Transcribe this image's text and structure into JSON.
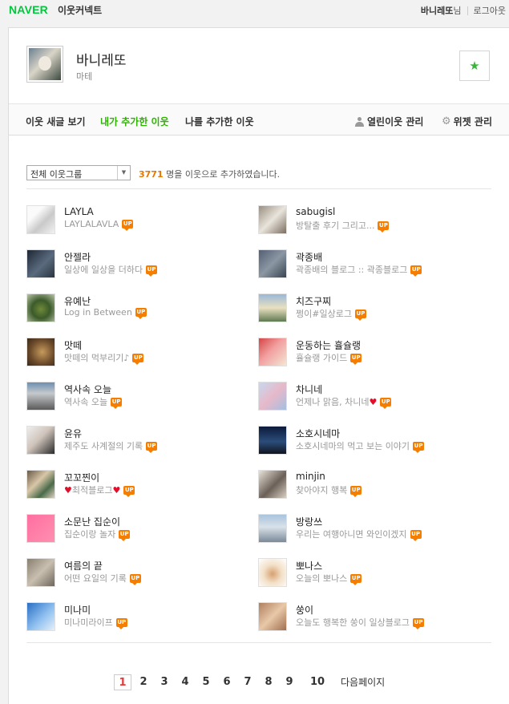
{
  "topbar": {
    "logo": "NAVER",
    "service": "이웃커넥트",
    "username": "바니레또",
    "nim": "님",
    "logout": "로그아웃"
  },
  "profile": {
    "name": "바니레또",
    "sub": "마테"
  },
  "tabs": {
    "new_posts": "이웃 새글 보기",
    "added_by_me": "내가 추가한 이웃",
    "added_me": "나를 추가한 이웃",
    "open_manage": "열린이웃 관리",
    "widget_manage": "위젯 관리"
  },
  "filter": {
    "group_select": "전체 이웃그룹",
    "count": "3771",
    "count_suffix": "명을 이웃으로 추가하였습니다."
  },
  "neighbors": [
    {
      "name": "LAYLA",
      "desc": "LAYLALAVLA",
      "heart": false
    },
    {
      "name": "sabugisl",
      "desc": "방탈출 후기 그리고...",
      "heart": false
    },
    {
      "name": "안젤라",
      "desc": "일상에 일상을 더하다",
      "heart": false
    },
    {
      "name": "곽종배",
      "desc": "곽종배의 블로그 :: 곽종블로그",
      "heart": false
    },
    {
      "name": "유예난",
      "desc": "Log in Between",
      "heart": false
    },
    {
      "name": "치즈구찌",
      "desc": "쩡이#일상로그",
      "heart": false
    },
    {
      "name": "맛떼",
      "desc": "맛떼의 먹부리기♪",
      "heart": false
    },
    {
      "name": "운동하는 휼슐랭",
      "desc": "휼슐랭 가이드",
      "heart": false
    },
    {
      "name": "역사속 오늘",
      "desc": "역사속 오늘",
      "heart": false
    },
    {
      "name": "차니네",
      "desc": "언제나 맑음, 차니네",
      "heart": true
    },
    {
      "name": "윤유",
      "desc": "제주도 사계절의 기록",
      "heart": false
    },
    {
      "name": "소호시네마",
      "desc": "소호시네마의 먹고 보는 이야기",
      "heart": false
    },
    {
      "name": "꼬꼬찐이",
      "desc": "최적블로그",
      "heart": true,
      "heart_before": true
    },
    {
      "name": "minjin",
      "desc": "찾아야지 행복",
      "heart": false
    },
    {
      "name": "소문난 집순이",
      "desc": "집순이랑 놀자",
      "heart": false
    },
    {
      "name": "방랑쓰",
      "desc": "우리는 여행아니면 와인이겠지",
      "heart": false
    },
    {
      "name": "여름의 끝",
      "desc": "어떤 요일의 기록",
      "heart": false
    },
    {
      "name": "뽀나스",
      "desc": "오늘의 뽀나스",
      "heart": false
    },
    {
      "name": "미나미",
      "desc": "미나미라이프",
      "heart": false
    },
    {
      "name": "쑹이",
      "desc": "오늘도 행복한 쑹이 일상블로그",
      "heart": false
    }
  ],
  "up_badge": "UP",
  "pager": {
    "pages": [
      "1",
      "2",
      "3",
      "4",
      "5",
      "6",
      "7",
      "8",
      "9",
      "10"
    ],
    "current": "1",
    "next": "다음페이지"
  },
  "colors": {
    "naver_green": "#00c73c",
    "active_tab": "#2db400",
    "count_orange": "#e67700",
    "up_badge": "#f57d00",
    "current_page": "#e03c3c"
  }
}
